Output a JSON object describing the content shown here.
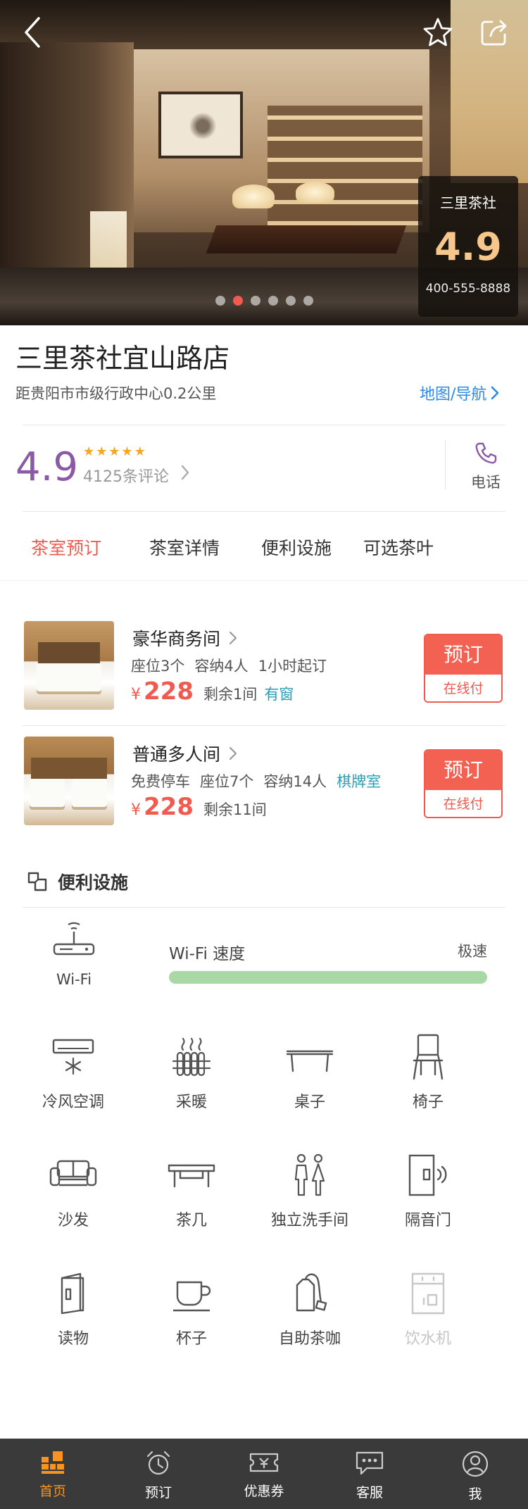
{
  "hero": {
    "store_short_name": "三里茶社",
    "score": "4.9",
    "phone": "400-555-8888",
    "carousel_total": 6,
    "carousel_active": 2
  },
  "shop": {
    "title": "三里茶社宜山路店",
    "distance": "距贵阳市市级行政中心0.2公里",
    "map_link": "地图/导航"
  },
  "rating": {
    "score": "4.9",
    "stars": 5,
    "reviews": "4125条评论",
    "phone_label": "电话"
  },
  "tabs": [
    {
      "label": "茶室预订",
      "active": true
    },
    {
      "label": "茶室详情",
      "active": false
    },
    {
      "label": "便利设施",
      "active": false
    },
    {
      "label": "可选茶叶",
      "active": false
    }
  ],
  "rooms": [
    {
      "name": "豪华商务间",
      "tags": [
        "座位3个",
        "容纳4人",
        "1小时起订"
      ],
      "currency": "¥",
      "price": "228",
      "remain": "剩余1间",
      "highlight": "有窗",
      "book_label": "预订",
      "pay_label": "在线付"
    },
    {
      "name": "普通多人间",
      "tags": [
        "免费停车",
        "座位7个",
        "容纳14人"
      ],
      "tag_highlight": "棋牌室",
      "currency": "¥",
      "price": "228",
      "remain": "剩余11间",
      "book_label": "预订",
      "pay_label": "在线付"
    }
  ],
  "facilities": {
    "title": "便利设施",
    "wifi_label": "Wi-Fi",
    "wifi_speed_label": "Wi-Fi 速度",
    "wifi_speed_value": "极速",
    "wifi_speed_level": 1.0,
    "items": [
      {
        "label": "冷风空调",
        "icon": "air-conditioner-icon",
        "available": true
      },
      {
        "label": "采暖",
        "icon": "heater-icon",
        "available": true
      },
      {
        "label": "桌子",
        "icon": "table-icon",
        "available": true
      },
      {
        "label": "椅子",
        "icon": "chair-icon",
        "available": true
      },
      {
        "label": "沙发",
        "icon": "sofa-icon",
        "available": true
      },
      {
        "label": "茶几",
        "icon": "tea-table-icon",
        "available": true
      },
      {
        "label": "独立洗手间",
        "icon": "restroom-icon",
        "available": true
      },
      {
        "label": "隔音门",
        "icon": "soundproof-door-icon",
        "available": true
      },
      {
        "label": "读物",
        "icon": "book-icon",
        "available": true
      },
      {
        "label": "杯子",
        "icon": "cup-icon",
        "available": true
      },
      {
        "label": "自助茶咖",
        "icon": "tea-bag-icon",
        "available": true
      },
      {
        "label": "饮水机",
        "icon": "water-dispenser-icon",
        "available": false
      }
    ]
  },
  "bottom_nav": [
    {
      "label": "首页",
      "icon": "home-icon",
      "active": true
    },
    {
      "label": "预订",
      "icon": "alarm-clock-icon",
      "active": false
    },
    {
      "label": "优惠券",
      "icon": "coupon-icon",
      "active": false
    },
    {
      "label": "客服",
      "icon": "chat-icon",
      "active": false
    },
    {
      "label": "我",
      "icon": "user-icon",
      "active": false
    }
  ],
  "colors": {
    "accent": "#f05a4f",
    "rating_purple": "#8a5aa6",
    "link_blue": "#2a8ae6",
    "tag_teal": "#2a9db5",
    "nav_active": "#f7931e",
    "wifi_bar": "#a9d8a6"
  }
}
